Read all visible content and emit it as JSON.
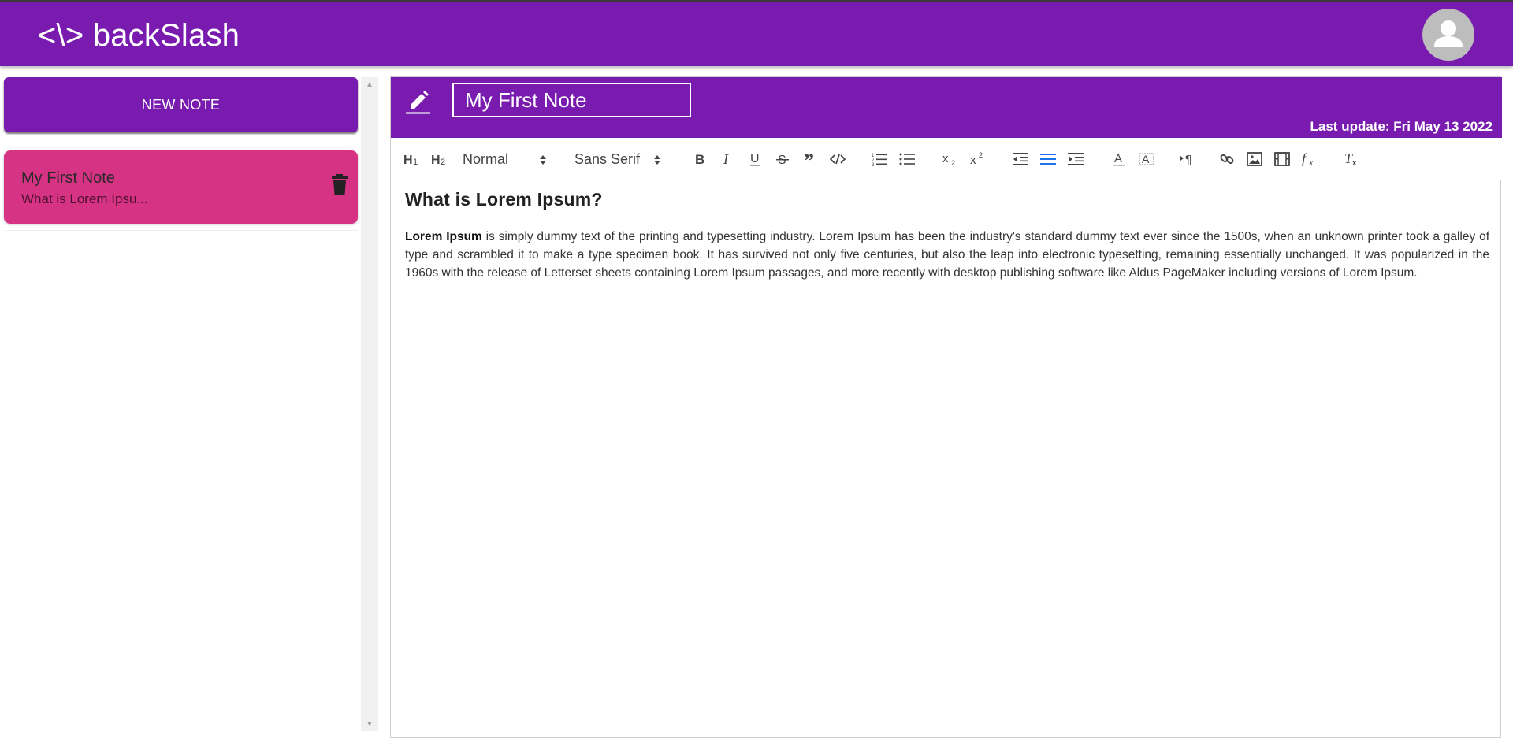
{
  "app": {
    "brand": "<\\> backSlash"
  },
  "header": {
    "avatar_icon": "account-circle-icon"
  },
  "sidebar": {
    "new_note_label": "NEW NOTE",
    "notes": [
      {
        "title": "My First Note",
        "preview": "What is Lorem Ipsu...",
        "action_icon": "trash-icon"
      }
    ]
  },
  "editor": {
    "title_value": "My First Note",
    "last_update": "Last update: Fri May 13 2022",
    "toolbar": {
      "header_picker": "Normal",
      "font_picker": "Sans Serif"
    },
    "content": {
      "heading": "What is Lorem Ipsum?",
      "lead_bold": "Lorem Ipsum",
      "body": " is simply dummy text of the printing and typesetting industry. Lorem Ipsum has been the industry's standard dummy text ever since the 1500s, when an unknown printer took a galley of type and scrambled it to make a type specimen book. It has survived not only five centuries, but also the leap into electronic typesetting, remaining essentially unchanged. It was popularized in the 1960s with the release of Letterset sheets containing Lorem Ipsum passages, and more recently with desktop publishing software like Aldus PageMaker including versions of Lorem Ipsum."
    }
  },
  "colors": {
    "primary": "#7a1bb0",
    "note_card": "#d63384",
    "active_tool": "#1a73e8"
  }
}
